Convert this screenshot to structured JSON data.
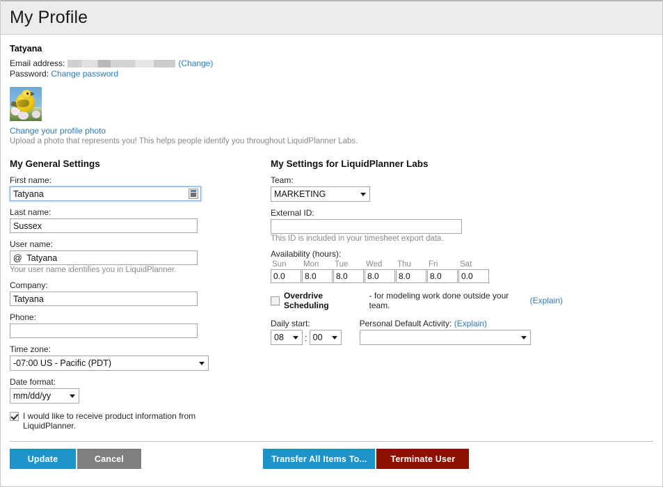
{
  "header": {
    "title": "My Profile"
  },
  "account": {
    "display_name": "Tatyana",
    "email_label": "Email address:",
    "email_value_redacted": "",
    "email_change_open": "(",
    "email_change_link": "Change",
    "email_change_close": ")",
    "password_label": "Password:",
    "password_change_link": "Change password",
    "photo_link": "Change your profile photo",
    "photo_hint": "Upload a photo that represents you! This helps people identify you throughout LiquidPlanner Labs."
  },
  "general": {
    "section_title": "My General Settings",
    "first_name": {
      "label": "First name:",
      "value": "Tatyana"
    },
    "last_name": {
      "label": "Last name:",
      "value": "Sussex"
    },
    "user_name": {
      "label": "User name:",
      "value": "@  Tatyana",
      "hint": "Your user name identifies you in LiquidPlanner."
    },
    "company": {
      "label": "Company:",
      "value": "Tatyana"
    },
    "phone": {
      "label": "Phone:",
      "value": "",
      "placeholder": ""
    },
    "time_zone": {
      "label": "Time zone:",
      "value": "-07:00 US - Pacific (PDT)"
    },
    "date_format": {
      "label": "Date format:",
      "value": "mm/dd/yy"
    },
    "newsletter": {
      "checked": true,
      "label": "I would like to receive product information from LiquidPlanner."
    }
  },
  "workspace": {
    "section_title": "My Settings for LiquidPlanner Labs",
    "team": {
      "label": "Team:",
      "value": "MARKETING"
    },
    "external_id": {
      "label": "External ID:",
      "value": "",
      "hint": "This ID is included in your timesheet export data."
    },
    "availability": {
      "label": "Availability (hours):",
      "days": [
        "Sun",
        "Mon",
        "Tue",
        "Wed",
        "Thu",
        "Fri",
        "Sat"
      ],
      "values": [
        "0.0",
        "8.0",
        "8.0",
        "8.0",
        "8.0",
        "8.0",
        "0.0"
      ]
    },
    "overdrive": {
      "checked": false,
      "title": "Overdrive Scheduling",
      "description": " - for modeling work done outside your team. ",
      "explain_open": "(",
      "explain_link": "Explain",
      "explain_close": ")"
    },
    "daily_start": {
      "label": "Daily start:",
      "hour": "08",
      "separator": ":",
      "minute": "00"
    },
    "default_activity": {
      "label": "Personal Default Activity: ",
      "explain_open": "(",
      "explain_link": "Explain",
      "explain_close": ")",
      "value": ""
    }
  },
  "footer": {
    "update": "Update",
    "cancel": "Cancel",
    "transfer": "Transfer All Items To...",
    "terminate": "Terminate User"
  },
  "colors": {
    "accent_blue": "#1d93c9",
    "link_blue": "#2b7bc0",
    "danger_red": "#8e1000",
    "neutral_gray": "#7f7f7f",
    "header_bg": "#ececec"
  }
}
